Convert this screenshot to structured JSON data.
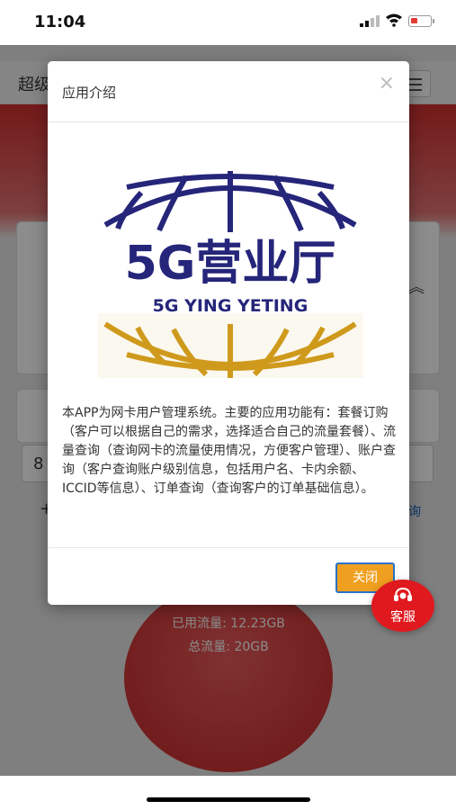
{
  "status_bar": {
    "time": "11:04"
  },
  "app": {
    "header_title": "超级",
    "field_value": "8",
    "plus_sign": "+",
    "link_stub": "询",
    "usage": {
      "used": "已用流量: 12.23GB",
      "total": "总流量: 20GB"
    }
  },
  "modal": {
    "title": "应用介绍",
    "close_icon": "×",
    "logo": {
      "main_text": "5G营业厅",
      "sub_text": "5G YING YETING",
      "colors": {
        "navy": "#25257a",
        "gold": "#cf9a1c"
      }
    },
    "body": "本APP为网卡用户管理系统。主要的应用功能有：套餐订购（客户可以根据自己的需求，选择适合自己的流量套餐）、流量查询（查询网卡的流量使用情况，方便客户管理）、账户查询（客户查询账户级别信息，包括用户名、卡内余额、ICCID等信息）、订单查询（查询客户的订单基础信息）。",
    "close_button": "关闭"
  },
  "fab": {
    "label": "客服"
  },
  "colors": {
    "accent_red": "#e0191f",
    "button_orange": "#f0a020",
    "button_border": "#2b72c8"
  }
}
